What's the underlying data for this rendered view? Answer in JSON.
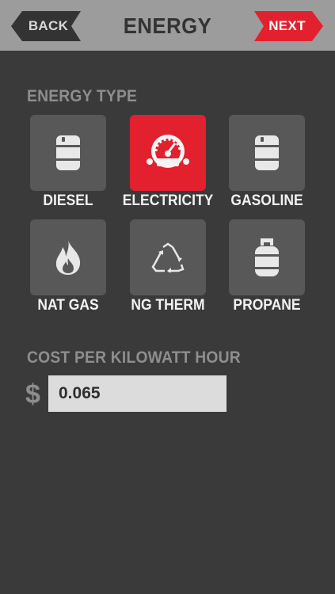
{
  "header": {
    "title": "ENERGY",
    "back_label": "BACK",
    "next_label": "NEXT",
    "next_color": "#e3202d"
  },
  "energy_type": {
    "section_label": "ENERGY TYPE",
    "selected": "ELECTRICITY",
    "options": [
      {
        "label": "DIESEL",
        "icon": "barrel-icon"
      },
      {
        "label": "ELECTRICITY",
        "icon": "meter-gauge-icon"
      },
      {
        "label": "GASOLINE",
        "icon": "barrel-icon"
      },
      {
        "label": "NAT GAS",
        "icon": "flame-icon"
      },
      {
        "label": "NG THERM",
        "icon": "recycle-triangle-icon"
      },
      {
        "label": "PROPANE",
        "icon": "propane-tank-icon"
      }
    ]
  },
  "cost": {
    "section_label": "COST PER KILOWATT HOUR",
    "currency_symbol": "$",
    "value": "0.065"
  },
  "colors": {
    "background": "#3a3a3a",
    "header": "#9c9c9c",
    "tile": "#585858",
    "selected": "#e3202d"
  }
}
